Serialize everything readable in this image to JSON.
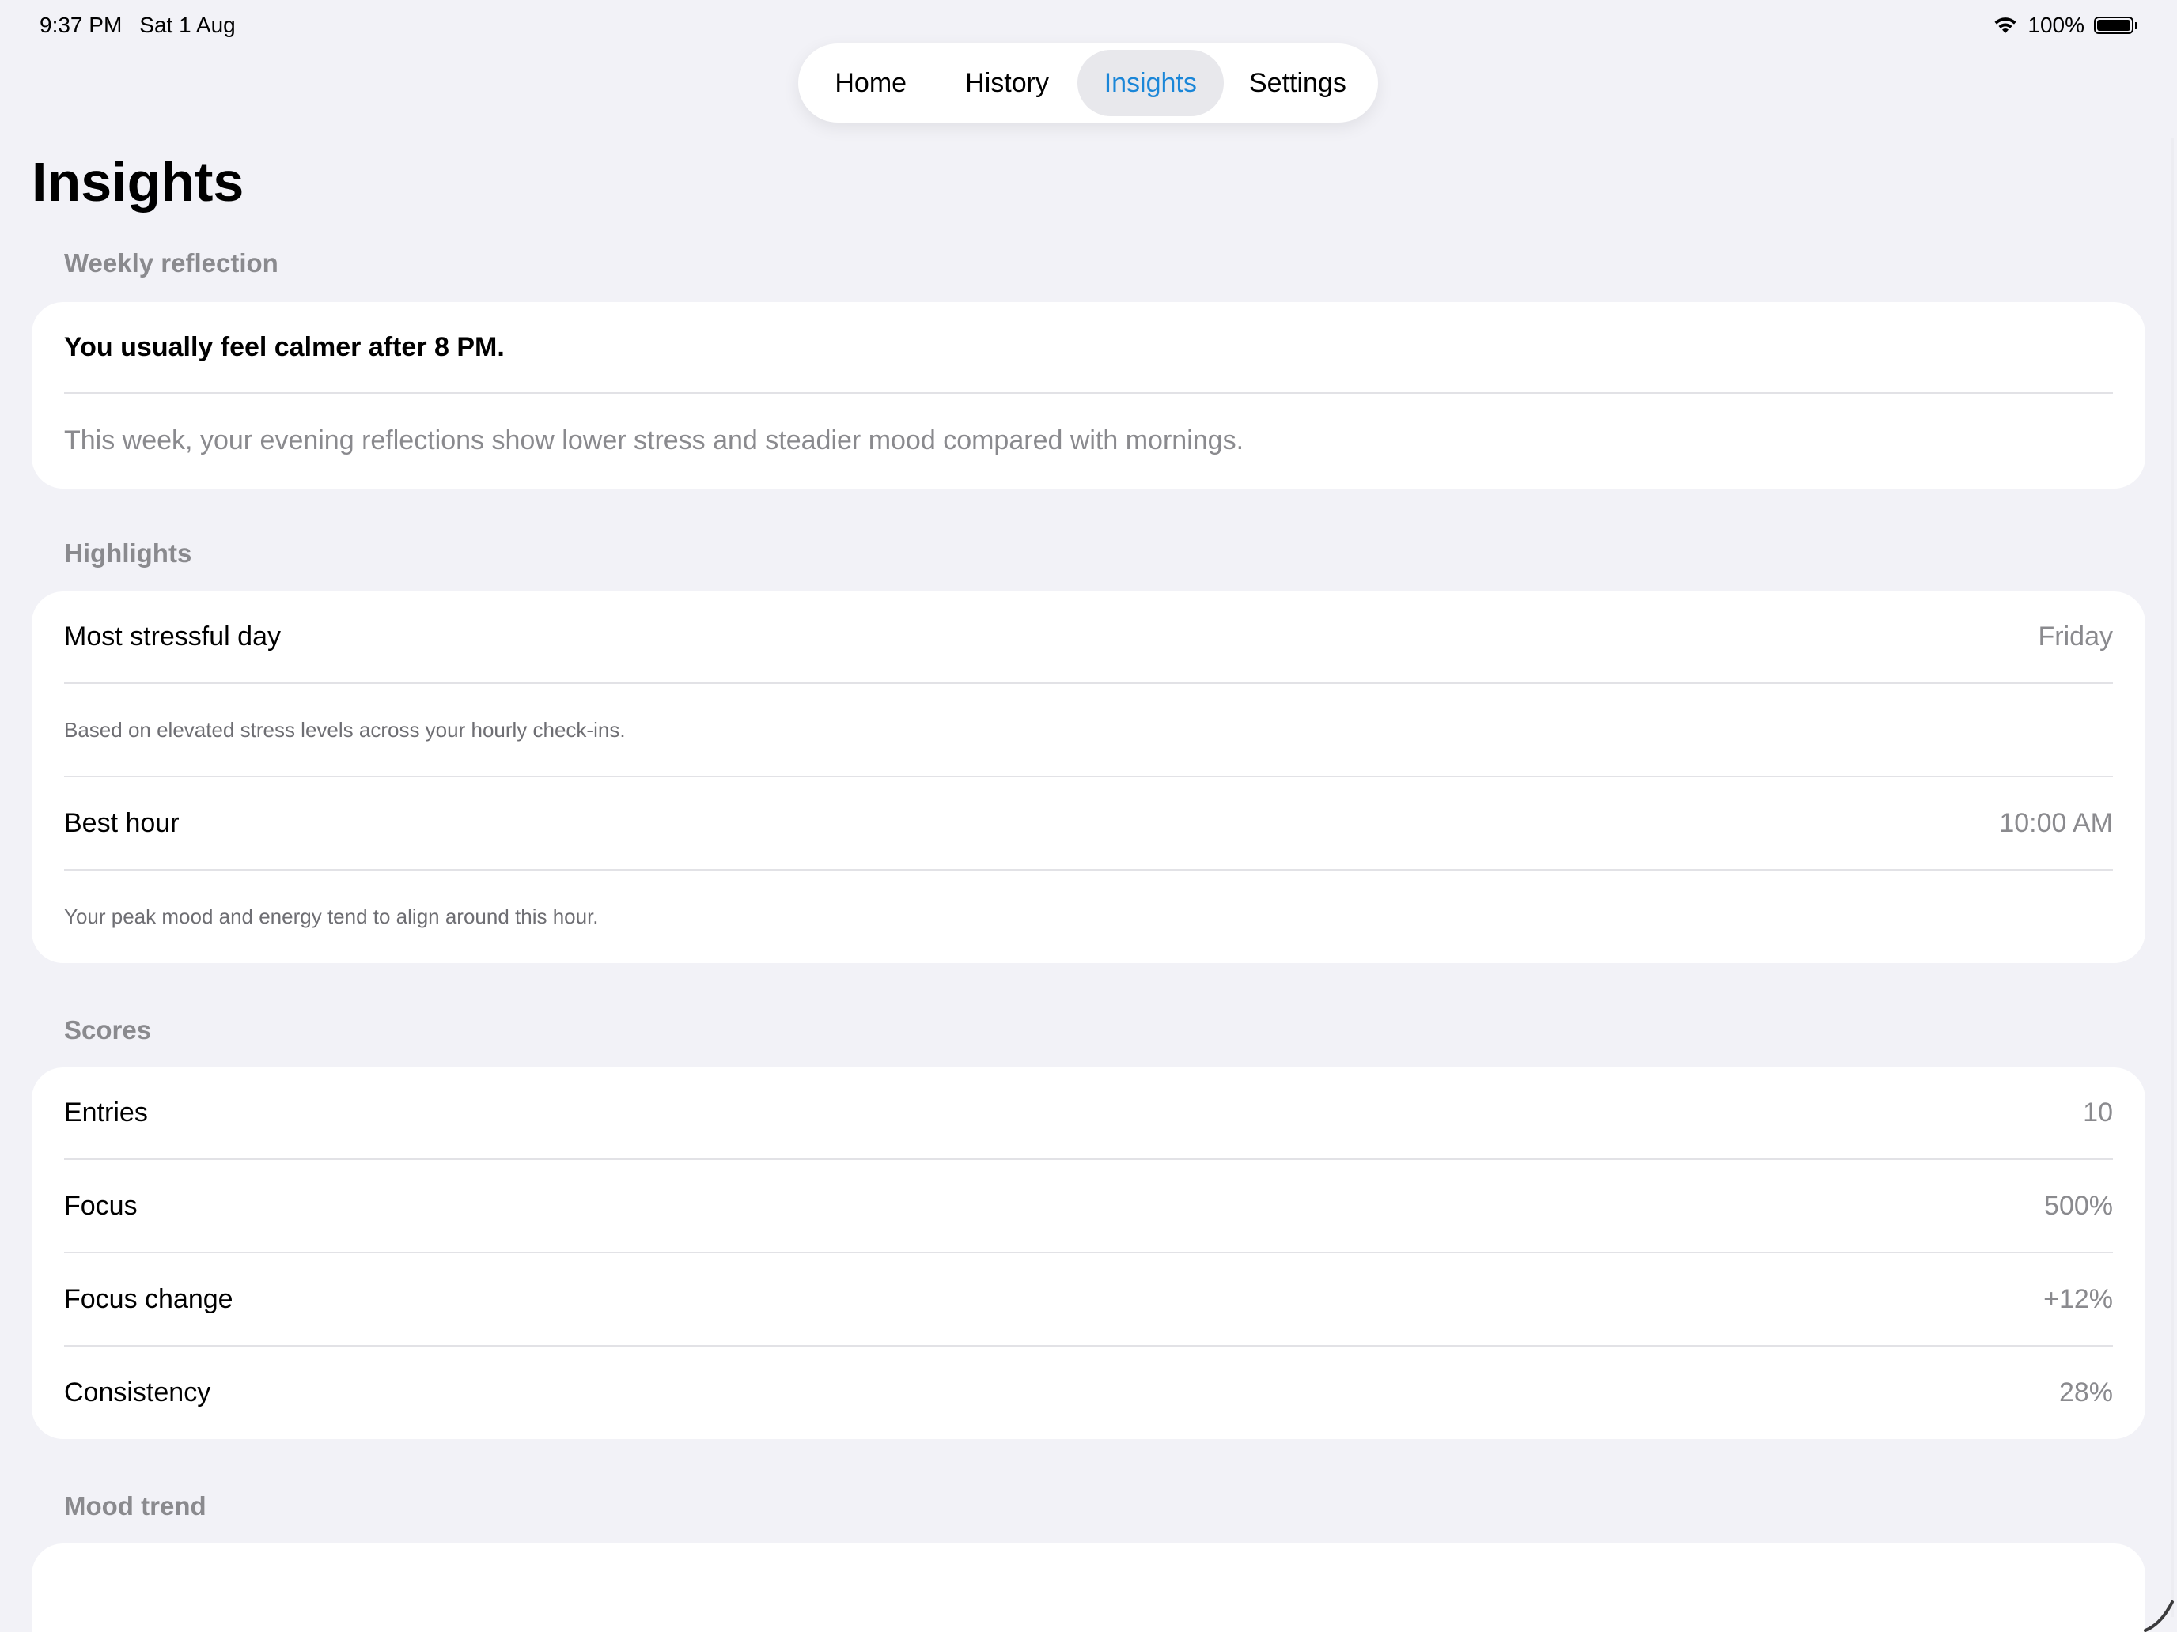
{
  "status_bar": {
    "time": "9:37 PM",
    "date": "Sat 1 Aug",
    "battery": "100%",
    "battery_level": 1.0
  },
  "tabs": [
    {
      "label": "Home"
    },
    {
      "label": "History"
    },
    {
      "label": "Insights",
      "active": true
    },
    {
      "label": "Settings"
    }
  ],
  "page": {
    "title": "Insights"
  },
  "weekly_reflection": {
    "label": "Weekly reflection",
    "headline": "You usually feel calmer after 8 PM.",
    "body": "This week, your evening reflections show lower stress and steadier mood compared with mornings."
  },
  "highlights": {
    "label": "Highlights",
    "most_stressful": {
      "label": "Most stressful day",
      "value": "Friday",
      "note": "Based on elevated stress levels across your hourly check-ins."
    },
    "best_hour": {
      "label": "Best hour",
      "value": "10:00 AM",
      "note": "Your peak mood and energy tend to align around this hour."
    }
  },
  "scores": {
    "label": "Scores",
    "rows": [
      {
        "label": "Entries",
        "value": "10"
      },
      {
        "label": "Focus",
        "value": "500%"
      },
      {
        "label": "Focus change",
        "value": "+12%"
      },
      {
        "label": "Consistency",
        "value": "28%"
      }
    ]
  },
  "mood_trend": {
    "label": "Mood trend"
  },
  "colors": {
    "accent": "#1a86d8",
    "background": "#f2f2f7",
    "card": "#ffffff",
    "secondary_text": "#8a8a8e"
  }
}
